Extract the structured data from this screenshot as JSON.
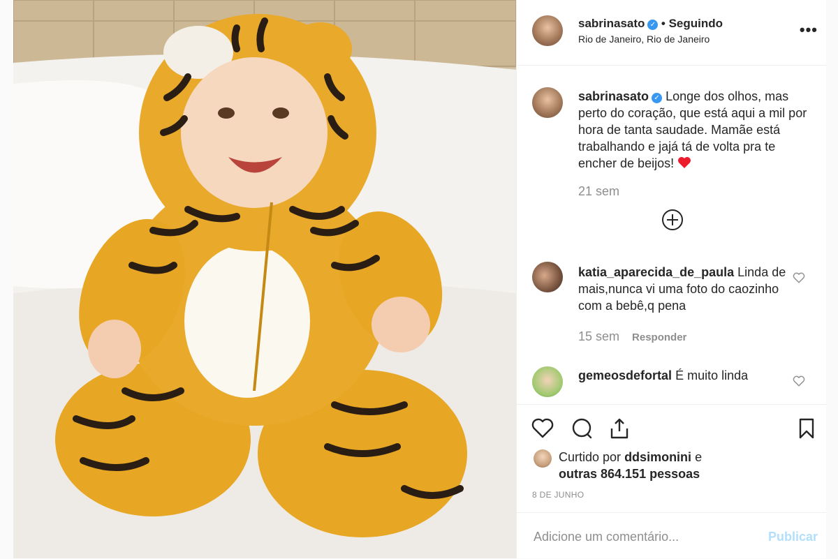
{
  "post": {
    "author": "sabrinasato",
    "follow_status": "• Seguindo",
    "location": "Rio de Janeiro, Rio de Janeiro",
    "more_icon": "•••",
    "caption_author": "sabrinasato",
    "caption_text": "Longe dos olhos, mas perto do coração, que está aqui a mil por hora de tanta saudade. Mamãe está trabalhando e jajá tá de volta pra te encher de beijos!",
    "caption_time": "21 sem"
  },
  "comments": [
    {
      "user": "katia_aparecida_de_paula",
      "text": "Linda de mais,nunca vi uma foto do caozinho com a bebê,q pena",
      "time": "15 sem",
      "reply": "Responder"
    },
    {
      "user": "gemeosdefortal",
      "text": "É muito linda"
    }
  ],
  "likes": {
    "prefix": "Curtido por",
    "user": "ddsimonini",
    "conj": "e",
    "others": "outras 864.151 pessoas"
  },
  "date": "8 DE JUNHO",
  "add_comment": {
    "placeholder": "Adicione um comentário...",
    "publish": "Publicar"
  },
  "colors": {
    "accent": "#3897f0",
    "heart": "#ed1b2e",
    "publish_disabled": "#b2dffc"
  }
}
